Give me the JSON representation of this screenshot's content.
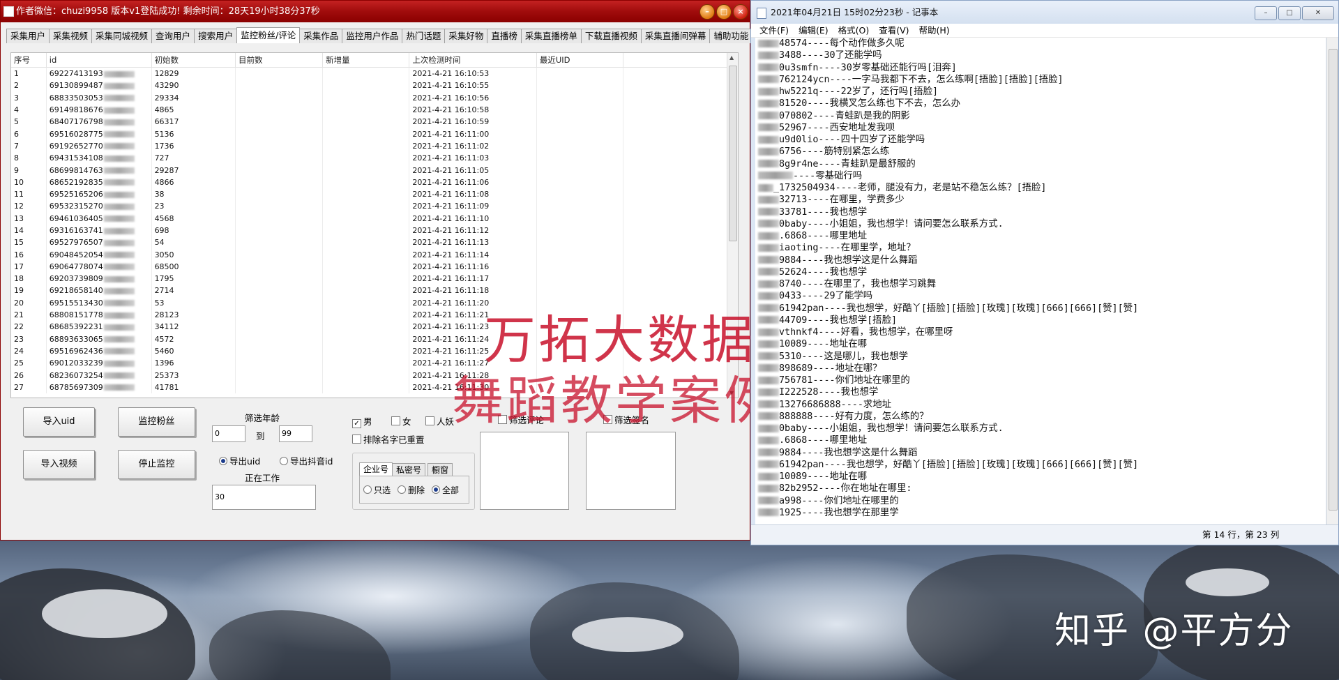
{
  "app": {
    "title": "作者微信：chuzi9958 版本v1登陆成功! 剩余时间：28天19小时38分37秒",
    "tabs": [
      "采集用户",
      "采集视频",
      "采集同城视频",
      "查询用户",
      "搜索用户",
      "监控粉丝/评论",
      "采集作品",
      "监控用户作品",
      "热门话题",
      "采集好物",
      "直播榜",
      "采集直播榜单",
      "下载直播视频",
      "采集直播间弹幕",
      "辅助功能"
    ],
    "active_tab": "监控粉丝/评论",
    "columns": [
      "序号",
      "id",
      "初始数",
      "目前数",
      "新增量",
      "上次检测时间",
      "最近UID"
    ],
    "rows": [
      {
        "n": "1",
        "id": "69227413193",
        "init": "12829",
        "time": "2021-4-21 16:10:53"
      },
      {
        "n": "2",
        "id": "69130899487",
        "init": "43290",
        "time": "2021-4-21 16:10:55"
      },
      {
        "n": "3",
        "id": "68833503053",
        "init": "29334",
        "time": "2021-4-21 16:10:56"
      },
      {
        "n": "4",
        "id": "69149818676",
        "init": "4865",
        "time": "2021-4-21 16:10:58"
      },
      {
        "n": "5",
        "id": "68407176798",
        "init": "66317",
        "time": "2021-4-21 16:10:59"
      },
      {
        "n": "6",
        "id": "69516028775",
        "init": "5136",
        "time": "2021-4-21 16:11:00"
      },
      {
        "n": "7",
        "id": "69192652770",
        "init": "1736",
        "time": "2021-4-21 16:11:02"
      },
      {
        "n": "8",
        "id": "69431534108",
        "init": "727",
        "time": "2021-4-21 16:11:03"
      },
      {
        "n": "9",
        "id": "68699814763",
        "init": "29287",
        "time": "2021-4-21 16:11:05"
      },
      {
        "n": "10",
        "id": "68652192835",
        "init": "4866",
        "time": "2021-4-21 16:11:06"
      },
      {
        "n": "11",
        "id": "69525165206",
        "init": "38",
        "time": "2021-4-21 16:11:08"
      },
      {
        "n": "12",
        "id": "69532315270",
        "init": "23",
        "time": "2021-4-21 16:11:09"
      },
      {
        "n": "13",
        "id": "69461036405",
        "init": "4568",
        "time": "2021-4-21 16:11:10"
      },
      {
        "n": "14",
        "id": "69316163741",
        "init": "698",
        "time": "2021-4-21 16:11:12"
      },
      {
        "n": "15",
        "id": "69527976507",
        "init": "54",
        "time": "2021-4-21 16:11:13"
      },
      {
        "n": "16",
        "id": "69048452054",
        "init": "3050",
        "time": "2021-4-21 16:11:14"
      },
      {
        "n": "17",
        "id": "69064778074",
        "init": "68500",
        "time": "2021-4-21 16:11:16"
      },
      {
        "n": "18",
        "id": "69203739809",
        "init": "1795",
        "time": "2021-4-21 16:11:17"
      },
      {
        "n": "19",
        "id": "69218658140",
        "init": "2714",
        "time": "2021-4-21 16:11:18"
      },
      {
        "n": "20",
        "id": "69515513430",
        "init": "53",
        "time": "2021-4-21 16:11:20"
      },
      {
        "n": "21",
        "id": "68808151778",
        "init": "28123",
        "time": "2021-4-21 16:11:21"
      },
      {
        "n": "22",
        "id": "68685392231",
        "init": "34112",
        "time": "2021-4-21 16:11:23"
      },
      {
        "n": "23",
        "id": "68893633065",
        "init": "4572",
        "time": "2021-4-21 16:11:24"
      },
      {
        "n": "24",
        "id": "69516962436",
        "init": "5460",
        "time": "2021-4-21 16:11:25"
      },
      {
        "n": "25",
        "id": "69012033239",
        "init": "1396",
        "time": "2021-4-21 16:11:27"
      },
      {
        "n": "26",
        "id": "68236073254",
        "init": "25373",
        "time": "2021-4-21 16:11:28"
      },
      {
        "n": "27",
        "id": "68785697309",
        "init": "41781",
        "time": "2021-4-21 16:11:30"
      }
    ],
    "buttons": {
      "import_uid": "导入uid",
      "monitor_fans": "监控粉丝",
      "import_video": "导入视频",
      "stop_monitor": "停止监控"
    },
    "age_filter": {
      "label": "筛选年龄",
      "min": "0",
      "to": "到",
      "max": "99"
    },
    "export": {
      "uid": "导出uid",
      "douyin_id": "导出抖音id"
    },
    "working": {
      "label": "正在工作",
      "value": "30"
    },
    "gender": {
      "male": "男",
      "female": "女",
      "other": "人妖"
    },
    "filters": {
      "exclude_dup": "排除名字已重置",
      "comment": "筛选评论",
      "signature": "筛选签名"
    },
    "subtabs": [
      "企业号",
      "私密号",
      "橱窗"
    ],
    "subtab_opts": {
      "only": "只选",
      "delete": "删除",
      "all": "全部"
    }
  },
  "overlay": {
    "line1": "万拓大数据",
    "line2": "舞蹈教学案例"
  },
  "notepad": {
    "title": "2021年04月21日 15时02分23秒 - 记事本",
    "menu": [
      "文件(F)",
      "编辑(E)",
      "格式(O)",
      "查看(V)",
      "帮助(H)"
    ],
    "lines": [
      "48574----每个动作做多久呢",
      "3488----30了还能学吗",
      "0u3smfn----30岁零基础还能行吗[泪奔]",
      "762124ycn----一字马我都下不去，怎么练啊[捂脸][捂脸][捂脸]",
      "hw5221q----22岁了，还行吗[捂脸]",
      "81520----我横叉怎么练也下不去，怎么办",
      "070802----青蛙趴是我的阴影",
      "52967----西安地址发我呗",
      "u9d0lio----四十四岁了还能学吗",
      "6756----筋特别紧怎么练",
      "8g9r4ne----青蛙趴是最舒服的",
      "----零基础行吗",
      "_1732504934----老师，腿没有力，老是站不稳怎么练？[捂脸]",
      "32713----在哪里，学费多少",
      "33781----我也想学",
      "0baby----小姐姐，我也想学！请问要怎么联系方式.",
      ".6868----哪里地址",
      "iaoting----在哪里学，地址？",
      "9884----我也想学这是什么舞蹈",
      "52624----我也想学",
      "8740----在哪里了，我也想学习跳舞",
      "0433----29了能学吗",
      "61942pan----我也想学，好酷丫[捂脸][捂脸][玫瑰][玫瑰][666][666][赞][赞]",
      "44709----我也想学[捂脸]",
      "vthnkf4----好看，我也想学，在哪里呀",
      "10089----地址在哪",
      "5310----这是哪儿，我也想学",
      "898689----地址在哪？",
      "756781----你们地址在哪里的",
      "I222528----我也想学",
      "13276686888----求地址",
      "888888----好有力度，怎么练的？",
      "0baby----小姐姐，我也想学！请问要怎么联系方式.",
      ".6868----哪里地址",
      "9884----我也想学这是什么舞蹈",
      "61942pan----我也想学，好酷丫[捂脸][捂脸][玫瑰][玫瑰][666][666][赞][赞]",
      "10089----地址在哪",
      "82b2952----你在地址在哪里:",
      "a998----你们地址在哪里的",
      "1925----我也想学在那里学"
    ],
    "status": "第 14 行，第 23 列"
  },
  "desktop": {
    "watermark": "知乎 @平方分"
  }
}
